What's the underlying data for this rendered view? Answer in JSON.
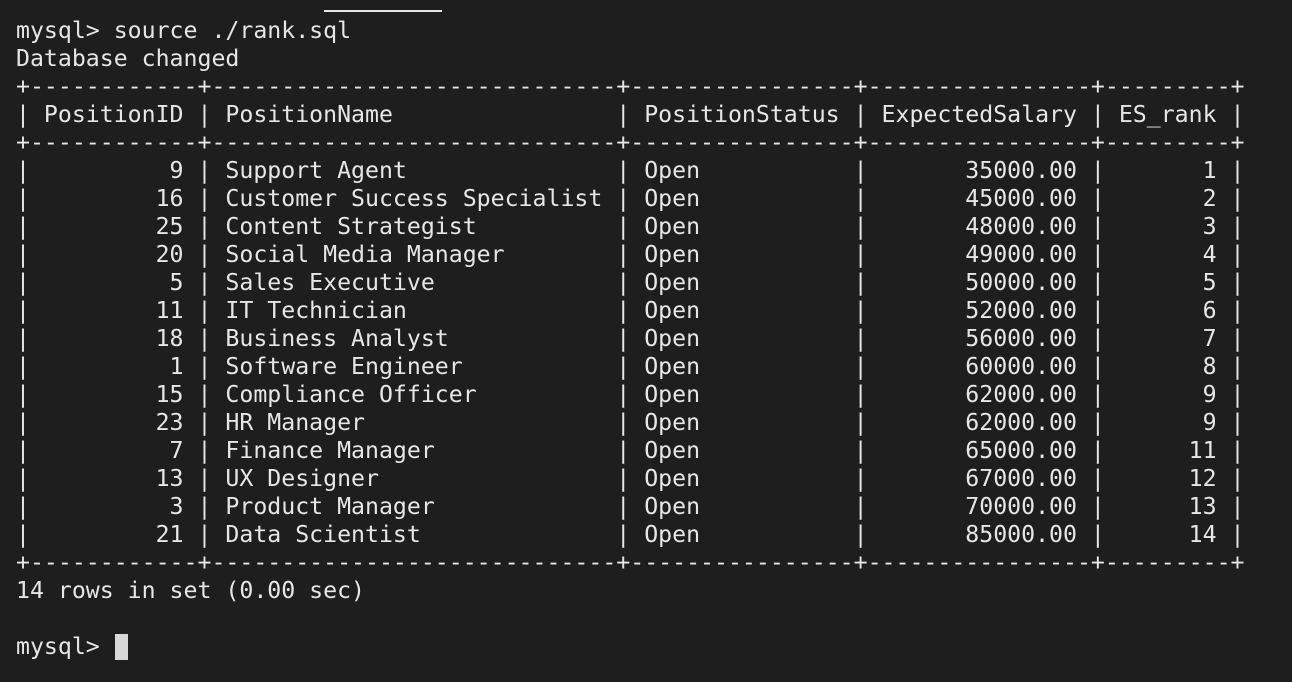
{
  "terminal": {
    "command_line": "mysql> source ./rank.sql",
    "db_changed": "Database changed",
    "border": "+------------+-----------------------------+----------------+----------------+---------+",
    "header_row": "| PositionID | PositionName                | PositionStatus | ExpectedSalary | ES_rank |",
    "rows": [
      "|          9 | Support Agent               | Open           |       35000.00 |       1 |",
      "|         16 | Customer Success Specialist | Open           |       45000.00 |       2 |",
      "|         25 | Content Strategist          | Open           |       48000.00 |       3 |",
      "|         20 | Social Media Manager        | Open           |       49000.00 |       4 |",
      "|          5 | Sales Executive             | Open           |       50000.00 |       5 |",
      "|         11 | IT Technician               | Open           |       52000.00 |       6 |",
      "|         18 | Business Analyst            | Open           |       56000.00 |       7 |",
      "|          1 | Software Engineer           | Open           |       60000.00 |       8 |",
      "|         15 | Compliance Officer          | Open           |       62000.00 |       9 |",
      "|         23 | HR Manager                  | Open           |       62000.00 |       9 |",
      "|          7 | Finance Manager             | Open           |       65000.00 |      11 |",
      "|         13 | UX Designer                 | Open           |       67000.00 |      12 |",
      "|          3 | Product Manager             | Open           |       70000.00 |      13 |",
      "|         21 | Data Scientist              | Open           |       85000.00 |      14 |"
    ],
    "footer": "14 rows in set (0.00 sec)",
    "blank": "",
    "prompt": "mysql> "
  }
}
